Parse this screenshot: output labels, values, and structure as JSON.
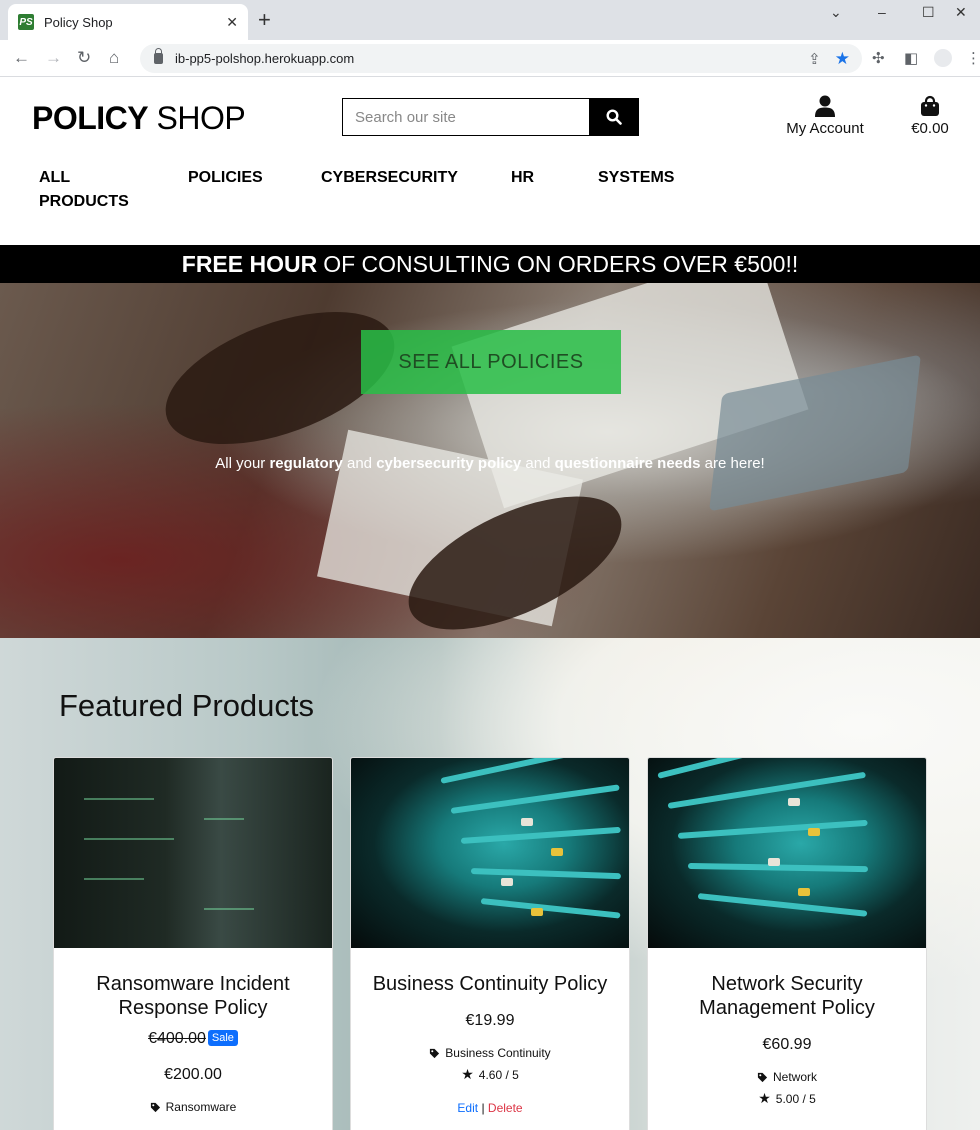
{
  "browser": {
    "tab_title": "Policy Shop",
    "favicon_text": "PS",
    "url": "ib-pp5-polshop.herokuapp.com"
  },
  "header": {
    "logo_bold": "POLICY",
    "logo_light": "SHOP",
    "search_placeholder": "Search our site",
    "account_label": "My Account",
    "bag_total": "€0.00"
  },
  "nav": {
    "items": [
      "ALL",
      "PRODUCTS",
      "POLICIES",
      "CYBERSECURITY",
      "HR",
      "SYSTEMS"
    ]
  },
  "banner": {
    "bold": "FREE HOUR",
    "rest": "OF CONSULTING ON ORDERS OVER €500!!"
  },
  "hero": {
    "cta": "SEE ALL POLICIES",
    "t1": "All your ",
    "b1": "regulatory",
    "t2": " and ",
    "b2": "cybersecurity policy",
    "t3": " and ",
    "b3": "questionnaire needs",
    "t4": " are here!"
  },
  "featured": {
    "title": "Featured Products",
    "products": [
      {
        "name_line1": "Ransomware Incident",
        "name_line2": "Response Policy",
        "old_price": "€400.00",
        "sale_label": "Sale",
        "price": "€200.00",
        "category": "Ransomware"
      },
      {
        "name_line1": "Business Continuity Policy",
        "price": "€19.99",
        "category": "Business Continuity",
        "rating": "4.60 / 5",
        "edit": "Edit",
        "separator": "|",
        "delete": "Delete"
      },
      {
        "name_line1": "Network Security",
        "name_line2": "Management Policy",
        "price": "€60.99",
        "category": "Network",
        "rating": "5.00 / 5"
      }
    ]
  }
}
